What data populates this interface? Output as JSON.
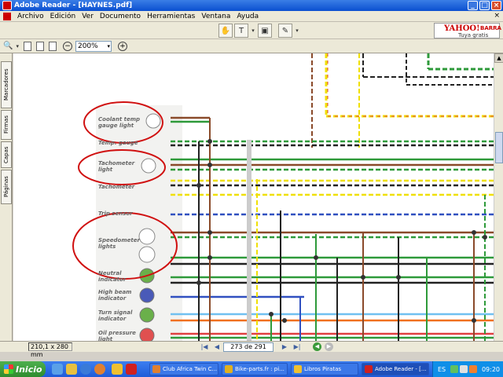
{
  "window": {
    "title": "Adobe Reader - [HAYNES.pdf]",
    "minimize": "_",
    "maximize": "□",
    "close": "×"
  },
  "menu": {
    "items": [
      "Archivo",
      "Edición",
      "Ver",
      "Documento",
      "Herramientas",
      "Ventana",
      "Ayuda"
    ],
    "ad_close": "×"
  },
  "ad": {
    "logo": "YAHOO!",
    "barra": "BARRA",
    "tagline": "Tuya gratis"
  },
  "toolbar2": {
    "zoom_value": "200%"
  },
  "side_tabs": [
    "Marcadores",
    "Firmas",
    "Capas",
    "Páginas"
  ],
  "status": {
    "page_size": "210,1 x 280 mm",
    "page_indicator": "273 de 291"
  },
  "diagram": {
    "labels": [
      {
        "id": "coolant",
        "text": "Coolant temp gauge light"
      },
      {
        "id": "temp-gauge",
        "text": "Temp. gauge"
      },
      {
        "id": "tacho-light",
        "text": "Tachometer light"
      },
      {
        "id": "tachometer",
        "text": "Tachometer"
      },
      {
        "id": "trip",
        "text": "Trip sensor"
      },
      {
        "id": "speedo",
        "text": "Speedometer lights"
      },
      {
        "id": "neutral",
        "text": "Neutral indicator"
      },
      {
        "id": "highbeam",
        "text": "High beam indicator"
      },
      {
        "id": "turn",
        "text": "Turn signal indicator"
      },
      {
        "id": "oil",
        "text": "Oil pressure light"
      }
    ],
    "colors": {
      "highlight": "#d01010",
      "green": "#2e9a3a",
      "yellow": "#f0e000",
      "brown": "#8a4a2a",
      "black": "#222222",
      "blue": "#3050c0",
      "lightblue": "#70c0f0",
      "orange": "#f07020",
      "red": "#e04040"
    }
  },
  "taskbar": {
    "start_label": "Inicio",
    "tasks": [
      {
        "label": "Club Africa Twin C..."
      },
      {
        "label": "Bike-parts.fr : pi..."
      },
      {
        "label": "Libros Piratas"
      },
      {
        "label": "Adobe Reader - [..."
      }
    ],
    "language": "ES",
    "clock": "09:20"
  }
}
